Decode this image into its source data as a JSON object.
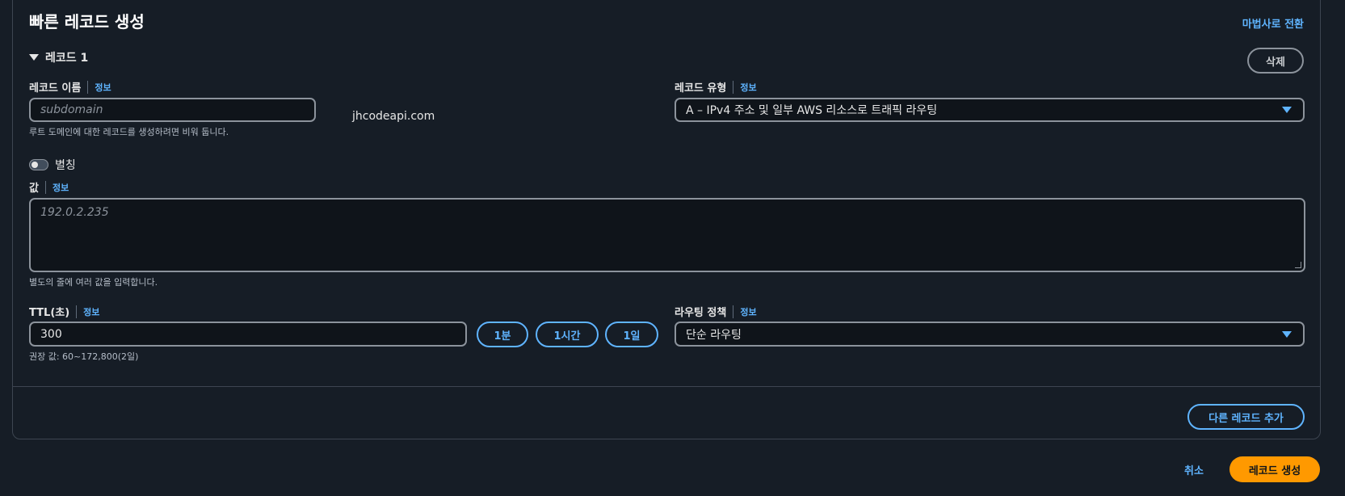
{
  "card": {
    "title": "빠른 레코드 생성",
    "wizard_link": "마법사로 전환"
  },
  "record": {
    "toggle_label": "레코드 1",
    "delete_label": "삭제"
  },
  "record_name": {
    "label": "레코드 이름",
    "info": "정보",
    "placeholder": "subdomain",
    "domain_suffix": "jhcodeapi.com",
    "hint": "루트 도메인에 대한 레코드를 생성하려면 비워 둡니다."
  },
  "record_type": {
    "label": "레코드 유형",
    "info": "정보",
    "selected": "A – IPv4 주소 및 일부 AWS 리소스로 트래픽 라우팅"
  },
  "alias": {
    "label": "별칭",
    "enabled": false
  },
  "value": {
    "label": "값",
    "info": "정보",
    "placeholder": "192.0.2.235",
    "hint": "별도의 줄에 여러 값을 입력합니다."
  },
  "ttl": {
    "label": "TTL(초)",
    "info": "정보",
    "value": "300",
    "hint": "권장 값: 60~172,800(2일)",
    "presets": [
      "1분",
      "1시간",
      "1일"
    ]
  },
  "routing_policy": {
    "label": "라우팅 정책",
    "info": "정보",
    "selected": "단순 라우팅"
  },
  "footer": {
    "add_record_label": "다른 레코드 추가",
    "cancel_label": "취소",
    "create_label": "레코드 생성"
  },
  "colors": {
    "accent": "#5fb4ff",
    "primary": "#ff9900",
    "background": "#161d26"
  }
}
